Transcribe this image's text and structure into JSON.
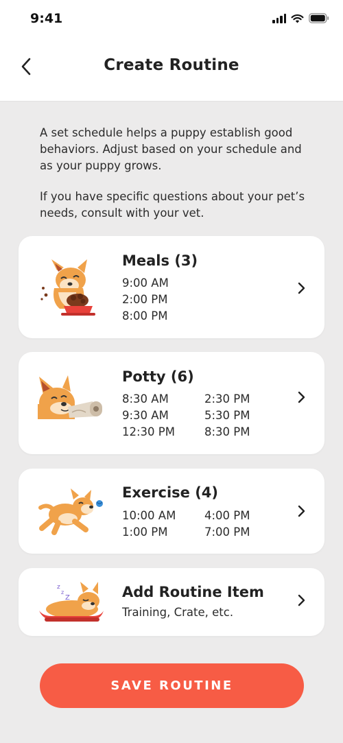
{
  "status_bar": {
    "time": "9:41"
  },
  "header": {
    "title": "Create Routine"
  },
  "intro": {
    "paragraph1": "A set schedule helps a puppy establish good behaviors. Adjust based on your schedule and as your puppy grows.",
    "paragraph2": "If you have specific questions about your pet’s needs, consult with your vet."
  },
  "routines": [
    {
      "title": "Meals (3)",
      "times": [
        "9:00 AM",
        "2:00 PM",
        "8:00 PM"
      ],
      "icon": "dog-eating-icon"
    },
    {
      "title": "Potty (6)",
      "times": [
        "8:30 AM",
        "2:30 PM",
        "9:30 AM",
        "5:30 PM",
        "12:30 PM",
        "8:30 PM"
      ],
      "icon": "dog-toilet-paper-icon"
    },
    {
      "title": "Exercise (4)",
      "times": [
        "10:00 AM",
        "4:00 PM",
        "1:00 PM",
        "7:00 PM"
      ],
      "icon": "dog-running-icon"
    }
  ],
  "add_item": {
    "title": "Add Routine Item",
    "subtitle": "Training, Crate, etc.",
    "icon": "dog-sleeping-icon"
  },
  "save_button": {
    "label": "SAVE ROUTINE"
  },
  "colors": {
    "accent": "#f75c45",
    "background": "#ecebeb",
    "dog_orange": "#f0a24a"
  }
}
